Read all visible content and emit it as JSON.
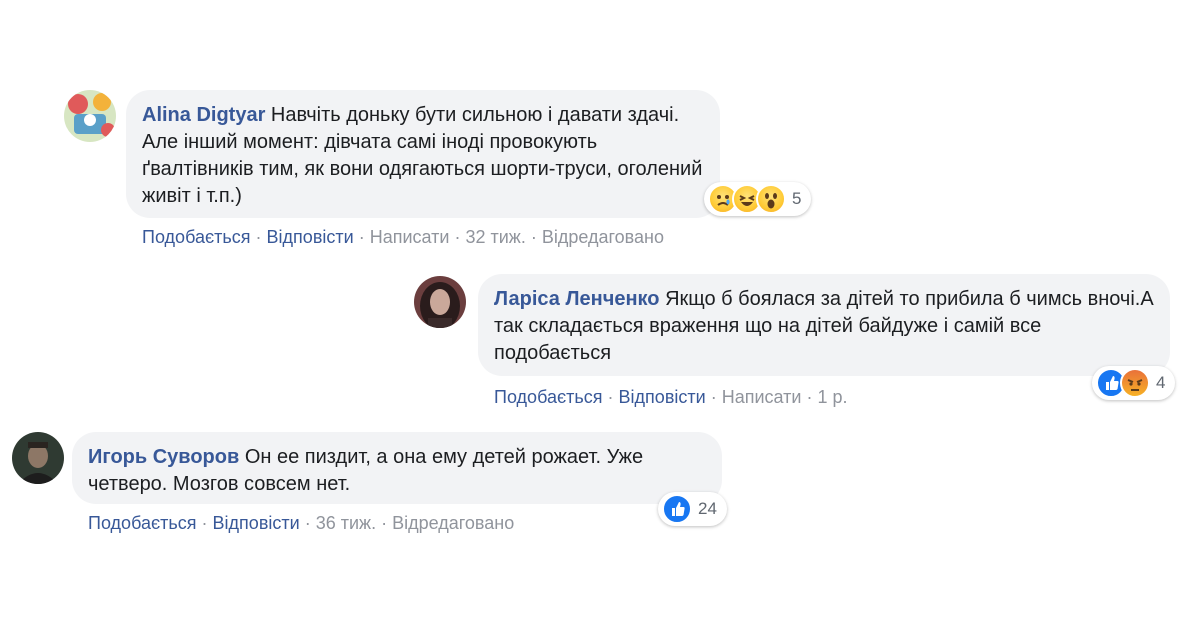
{
  "comments": [
    {
      "author": "Alina Digtyar",
      "text": "Навчіть доньку бути сильною і давати здачі. Але інший момент: дівчата самі іноді провокують ґвалтівників тим, як вони одягаються шорти-труси, оголений живіт і т.п.)",
      "actions": {
        "like": "Подобається",
        "reply": "Відповісти",
        "message": "Написати",
        "time": "32 тиж.",
        "edited": "Відредаговано"
      },
      "reactions": {
        "icons": [
          "sad-icon",
          "haha-icon",
          "wow-icon"
        ],
        "count": "5"
      },
      "avatar_colors": [
        "#d7e6c2",
        "#5aa0c8",
        "#e05a5a"
      ]
    },
    {
      "author": "Ларіса Ленченко",
      "text": "Якщо б боялася за дітей то прибила б чимсь вночі.А так складається враження що на дітей байдуже і самій все подобається",
      "actions": {
        "like": "Подобається",
        "reply": "Відповісти",
        "message": "Написати",
        "time": "1 р."
      },
      "reactions": {
        "icons": [
          "like-icon",
          "angry-icon"
        ],
        "count": "4"
      },
      "avatar_colors": [
        "#6b3e3e",
        "#caa89a",
        "#2a1c1c"
      ]
    },
    {
      "author": "Игорь Суворов",
      "text": "Он ее пиздит, а она ему детей рожает. Уже четверо. Мозгов совсем нет.",
      "actions": {
        "like": "Подобається",
        "reply": "Відповісти",
        "time": "36 тиж.",
        "edited": "Відредаговано"
      },
      "reactions": {
        "icons": [
          "like-icon"
        ],
        "count": "24"
      },
      "avatar_colors": [
        "#2f3a32",
        "#8d7766",
        "#1d1d1d"
      ]
    }
  ],
  "colors": {
    "bubble": "#f2f3f5",
    "link": "#385898",
    "muted": "#90949c",
    "like": "#1877f2"
  }
}
